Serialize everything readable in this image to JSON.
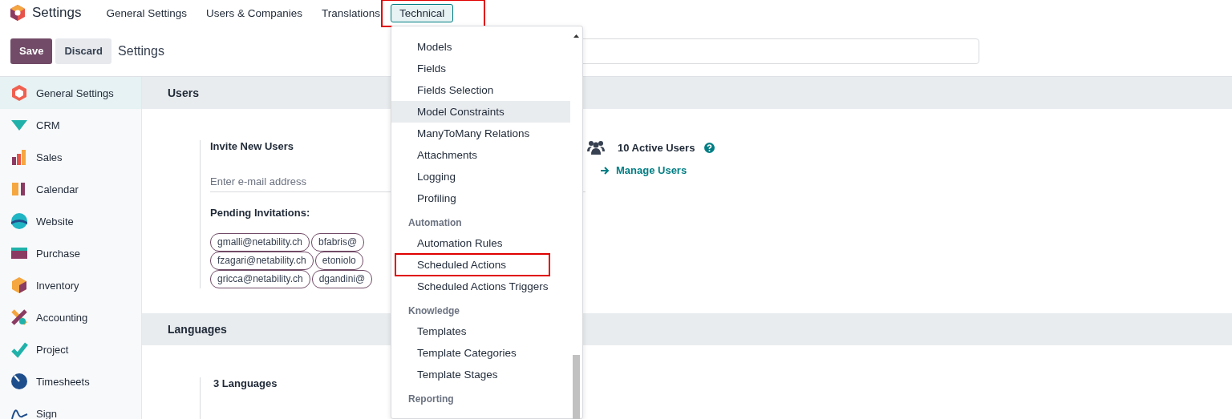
{
  "navbar": {
    "app_title": "Settings",
    "menus": [
      {
        "label": "General Settings",
        "open": false,
        "highlighted": false
      },
      {
        "label": "Users & Companies",
        "open": false,
        "highlighted": false
      },
      {
        "label": "Translations",
        "open": false,
        "highlighted": false
      },
      {
        "label": "Technical",
        "open": true,
        "highlighted": true
      }
    ]
  },
  "control_panel": {
    "buttons": [
      "Save",
      "Discard"
    ],
    "breadcrumb": "Settings"
  },
  "sidebar": {
    "items": [
      {
        "label": "General Settings",
        "selected": true
      },
      {
        "label": "CRM",
        "selected": false
      },
      {
        "label": "Sales",
        "selected": false
      },
      {
        "label": "Calendar",
        "selected": false
      },
      {
        "label": "Website",
        "selected": false
      },
      {
        "label": "Purchase",
        "selected": false
      },
      {
        "label": "Inventory",
        "selected": false
      },
      {
        "label": "Accounting",
        "selected": false
      },
      {
        "label": "Project",
        "selected": false
      },
      {
        "label": "Timesheets",
        "selected": false
      },
      {
        "label": "Sign",
        "selected": false
      }
    ]
  },
  "sections": [
    {
      "title": "Users",
      "invite": {
        "label": "Invite New Users",
        "placeholder": "Enter e-mail address",
        "pending_label": "Pending Invitations:",
        "tags": [
          [
            "gmalli@netability.ch",
            "bfabris@"
          ],
          [
            "fzagari@netability.ch",
            "etoniolo"
          ],
          [
            "gricca@netability.ch",
            "dgandini@"
          ]
        ]
      },
      "active_users": "10 Active Users",
      "manage_link": "Manage Users"
    },
    {
      "title": "Languages",
      "count": "3 Languages"
    }
  ],
  "dropdown": {
    "groups": [
      {
        "items": [
          {
            "label": "Models",
            "active": false,
            "highlighted": false
          },
          {
            "label": "Fields",
            "active": false,
            "highlighted": false
          },
          {
            "label": "Fields Selection",
            "active": false,
            "highlighted": false
          },
          {
            "label": "Model Constraints",
            "active": true,
            "highlighted": false
          },
          {
            "label": "ManyToMany Relations",
            "active": false,
            "highlighted": false
          },
          {
            "label": "Attachments",
            "active": false,
            "highlighted": false
          },
          {
            "label": "Logging",
            "active": false,
            "highlighted": false
          },
          {
            "label": "Profiling",
            "active": false,
            "highlighted": false
          }
        ]
      },
      {
        "title": "Automation",
        "items": [
          {
            "label": "Automation Rules",
            "active": false,
            "highlighted": false
          },
          {
            "label": "Scheduled Actions",
            "active": false,
            "highlighted": true
          },
          {
            "label": "Scheduled Actions Triggers",
            "active": false,
            "highlighted": false
          }
        ]
      },
      {
        "title": "Knowledge",
        "items": [
          {
            "label": "Templates",
            "active": false,
            "highlighted": false
          },
          {
            "label": "Template Categories",
            "active": false,
            "highlighted": false
          },
          {
            "label": "Template Stages",
            "active": false,
            "highlighted": false
          }
        ]
      },
      {
        "title": "Reporting"
      }
    ]
  }
}
